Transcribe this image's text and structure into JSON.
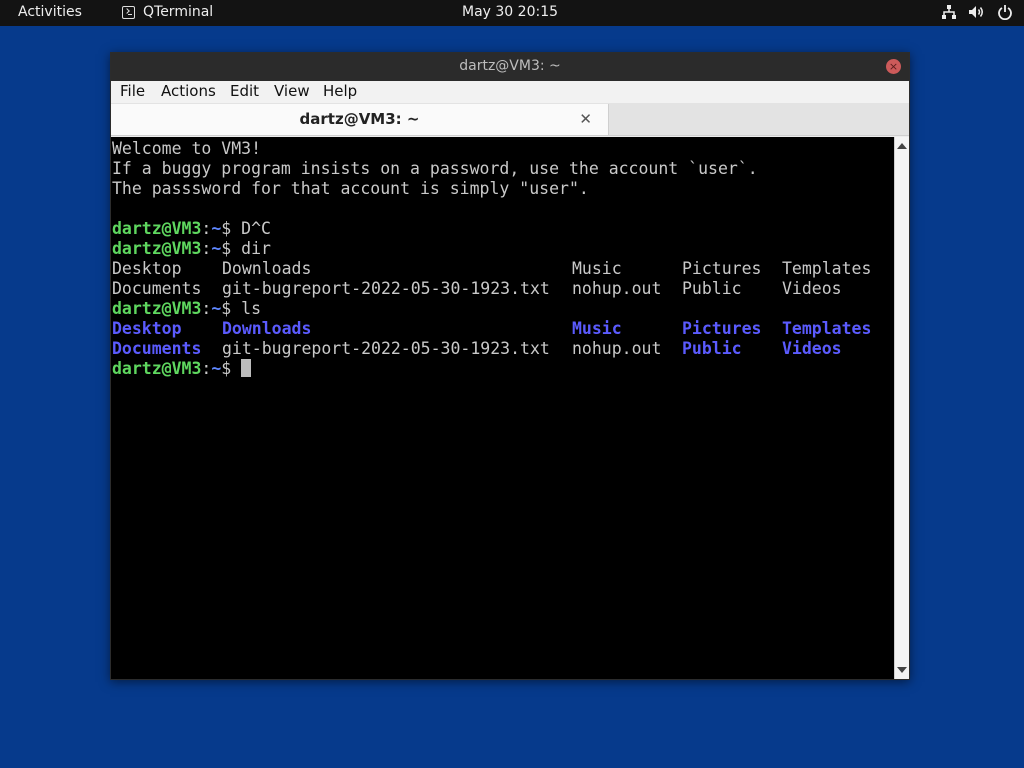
{
  "topbar": {
    "activities": "Activities",
    "app_name": "QTerminal",
    "clock": "May 30  20:15",
    "icons": [
      "network-icon",
      "volume-icon",
      "power-icon"
    ]
  },
  "window": {
    "title": "dartz@VM3: ~",
    "close_glyph": "×",
    "menu": [
      "File",
      "Actions",
      "Edit",
      "View",
      "Help"
    ],
    "tab": {
      "title": "dartz@VM3: ~",
      "close_glyph": "✕"
    }
  },
  "terminal": {
    "welcome": [
      "Welcome to VM3!",
      "If a buggy program insists on a password, use the account `user`.",
      "The passsword for that account is simply \"user\"."
    ],
    "prompt_user": "dartz@VM3",
    "prompt_path": "~",
    "prompt_sep": ":",
    "prompt_end": "$ ",
    "commands": [
      "D^C",
      "dir",
      "ls"
    ],
    "dir_rows": [
      [
        "Desktop",
        "Downloads",
        "Music",
        "Pictures",
        "Templates"
      ],
      [
        "Documents",
        "git-bugreport-2022-05-30-1923.txt",
        "nohup.out",
        "Public",
        "Videos"
      ]
    ],
    "ls_rows": [
      [
        {
          "t": "Desktop",
          "d": true
        },
        {
          "t": "Downloads",
          "d": true
        },
        {
          "t": "Music",
          "d": true
        },
        {
          "t": "Pictures",
          "d": true
        },
        {
          "t": "Templates",
          "d": true
        }
      ],
      [
        {
          "t": "Documents",
          "d": true
        },
        {
          "t": "git-bugreport-2022-05-30-1923.txt",
          "d": false
        },
        {
          "t": "nohup.out",
          "d": false
        },
        {
          "t": "Public",
          "d": true
        },
        {
          "t": "Videos",
          "d": true
        }
      ]
    ]
  },
  "colors": {
    "desktop": "#063a8c",
    "prompt_user": "#5fd75f",
    "prompt_path": "#5f87ff",
    "directory": "#5b5bff"
  }
}
